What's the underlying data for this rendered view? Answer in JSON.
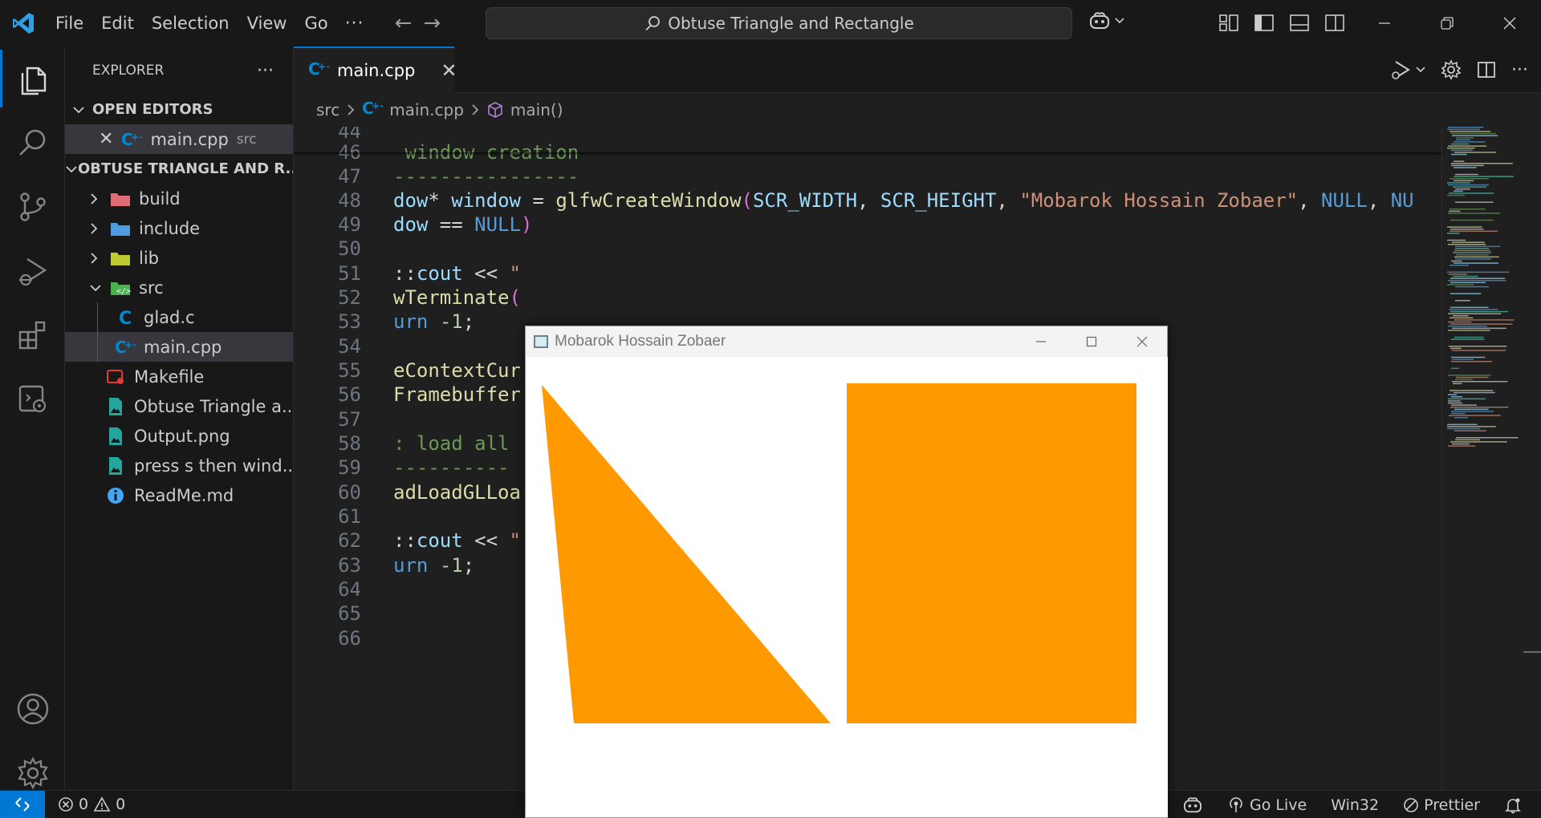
{
  "menu": {
    "items": [
      "File",
      "Edit",
      "Selection",
      "View",
      "Go"
    ],
    "more": "···"
  },
  "search": {
    "text": "Obtuse Triangle and Rectangle"
  },
  "explorer": {
    "title": "EXPLORER",
    "more": "···",
    "open_editors_label": "OPEN EDITORS",
    "open_editor": {
      "name": "main.cpp",
      "dir": "src"
    },
    "project_label": "OBTUSE TRIANGLE AND R...",
    "tree": [
      {
        "name": "build",
        "kind": "folder",
        "icon": "folder-build-icon",
        "color": "#e06c75"
      },
      {
        "name": "include",
        "kind": "folder",
        "icon": "folder-include-icon",
        "color": "#4d9de0"
      },
      {
        "name": "lib",
        "kind": "folder",
        "icon": "folder-lib-icon",
        "color": "#c0ca33"
      },
      {
        "name": "src",
        "kind": "folder-open",
        "icon": "folder-src-icon",
        "color": "#4caf50"
      },
      {
        "name": "glad.c",
        "kind": "file",
        "icon": "c-file-icon",
        "color": "#0288d1"
      },
      {
        "name": "main.cpp",
        "kind": "file",
        "icon": "cpp-file-icon",
        "color": "#0288d1"
      },
      {
        "name": "Makefile",
        "kind": "file",
        "icon": "makefile-icon",
        "color": "#e53935"
      },
      {
        "name": "Obtuse Triangle a...",
        "kind": "file",
        "icon": "image-file-icon",
        "color": "#26a69a"
      },
      {
        "name": "Output.png",
        "kind": "file",
        "icon": "image-file-icon",
        "color": "#26a69a"
      },
      {
        "name": "press s then wind...",
        "kind": "file",
        "icon": "image-file-icon",
        "color": "#26a69a"
      },
      {
        "name": "ReadMe.md",
        "kind": "file",
        "icon": "info-icon",
        "color": "#42a5f5"
      }
    ]
  },
  "tab": {
    "label": "main.cpp",
    "close": "✕"
  },
  "breadcrumb": {
    "folder": "src",
    "file": "main.cpp",
    "symbol": "main()"
  },
  "code": {
    "lines": [
      {
        "n": "44",
        "t": []
      },
      {
        "n": "46",
        "t": [
          [
            "c-com",
            " window creation"
          ]
        ]
      },
      {
        "n": "47",
        "t": [
          [
            "c-com",
            "----------------"
          ]
        ]
      },
      {
        "n": "48",
        "t": [
          [
            "c-id",
            "dow"
          ],
          [
            "c-op",
            "* "
          ],
          [
            "c-id",
            "window"
          ],
          [
            "c-op",
            " = "
          ],
          [
            "c-fn",
            "glfwCreateWindow"
          ],
          [
            "c-par",
            "("
          ],
          [
            "c-id",
            "SCR_WIDTH"
          ],
          [
            "c-op",
            ", "
          ],
          [
            "c-id",
            "SCR_HEIGHT"
          ],
          [
            "c-op",
            ", "
          ],
          [
            "c-str",
            "\"Mobarok Hossain Zobaer\""
          ],
          [
            "c-op",
            ", "
          ],
          [
            "c-kw",
            "NULL"
          ],
          [
            "c-op",
            ", "
          ],
          [
            "c-kw",
            "NU"
          ]
        ]
      },
      {
        "n": "49",
        "t": [
          [
            "c-id",
            "dow"
          ],
          [
            "c-op",
            " == "
          ],
          [
            "c-kw",
            "NULL"
          ],
          [
            "c-par",
            ")"
          ]
        ]
      },
      {
        "n": "50",
        "t": []
      },
      {
        "n": "51",
        "t": [
          [
            "c-op",
            "::"
          ],
          [
            "c-id",
            "cout"
          ],
          [
            "c-op",
            " << "
          ],
          [
            "c-str",
            "\""
          ]
        ]
      },
      {
        "n": "52",
        "t": [
          [
            "c-fn",
            "wTerminate"
          ],
          [
            "c-par",
            "("
          ]
        ]
      },
      {
        "n": "53",
        "t": [
          [
            "c-kw",
            "urn"
          ],
          [
            "c-op",
            " "
          ],
          [
            "c-num",
            "-1"
          ],
          [
            "c-op",
            ";"
          ]
        ]
      },
      {
        "n": "54",
        "t": []
      },
      {
        "n": "55",
        "t": [
          [
            "c-fn",
            "eContextCur"
          ]
        ]
      },
      {
        "n": "56",
        "t": [
          [
            "c-fn",
            "Framebuffer"
          ]
        ]
      },
      {
        "n": "57",
        "t": []
      },
      {
        "n": "58",
        "t": [
          [
            "c-com",
            ": load all "
          ]
        ]
      },
      {
        "n": "59",
        "t": [
          [
            "c-com",
            "----------"
          ]
        ]
      },
      {
        "n": "60",
        "t": [
          [
            "c-fn",
            "adLoadGLLoa"
          ]
        ]
      },
      {
        "n": "61",
        "t": []
      },
      {
        "n": "62",
        "t": [
          [
            "c-op",
            "::"
          ],
          [
            "c-id",
            "cout"
          ],
          [
            "c-op",
            " << "
          ],
          [
            "c-str",
            "\""
          ]
        ]
      },
      {
        "n": "63",
        "t": [
          [
            "c-kw",
            "urn"
          ],
          [
            "c-op",
            " "
          ],
          [
            "c-num",
            "-1"
          ],
          [
            "c-op",
            ";"
          ]
        ]
      },
      {
        "n": "64",
        "t": []
      },
      {
        "n": "65",
        "t": []
      },
      {
        "n": "66",
        "t": []
      }
    ]
  },
  "status": {
    "errors": "0",
    "warnings": "0",
    "plus": "+",
    "go_live": "Go Live",
    "platform": "Win32",
    "prettier": "Prettier"
  },
  "glwindow": {
    "title": "Mobarok Hossain Zobaer",
    "shape_color": "#ff9900",
    "background": "#ffffff"
  },
  "colors": {
    "accent": "#0078d4"
  }
}
